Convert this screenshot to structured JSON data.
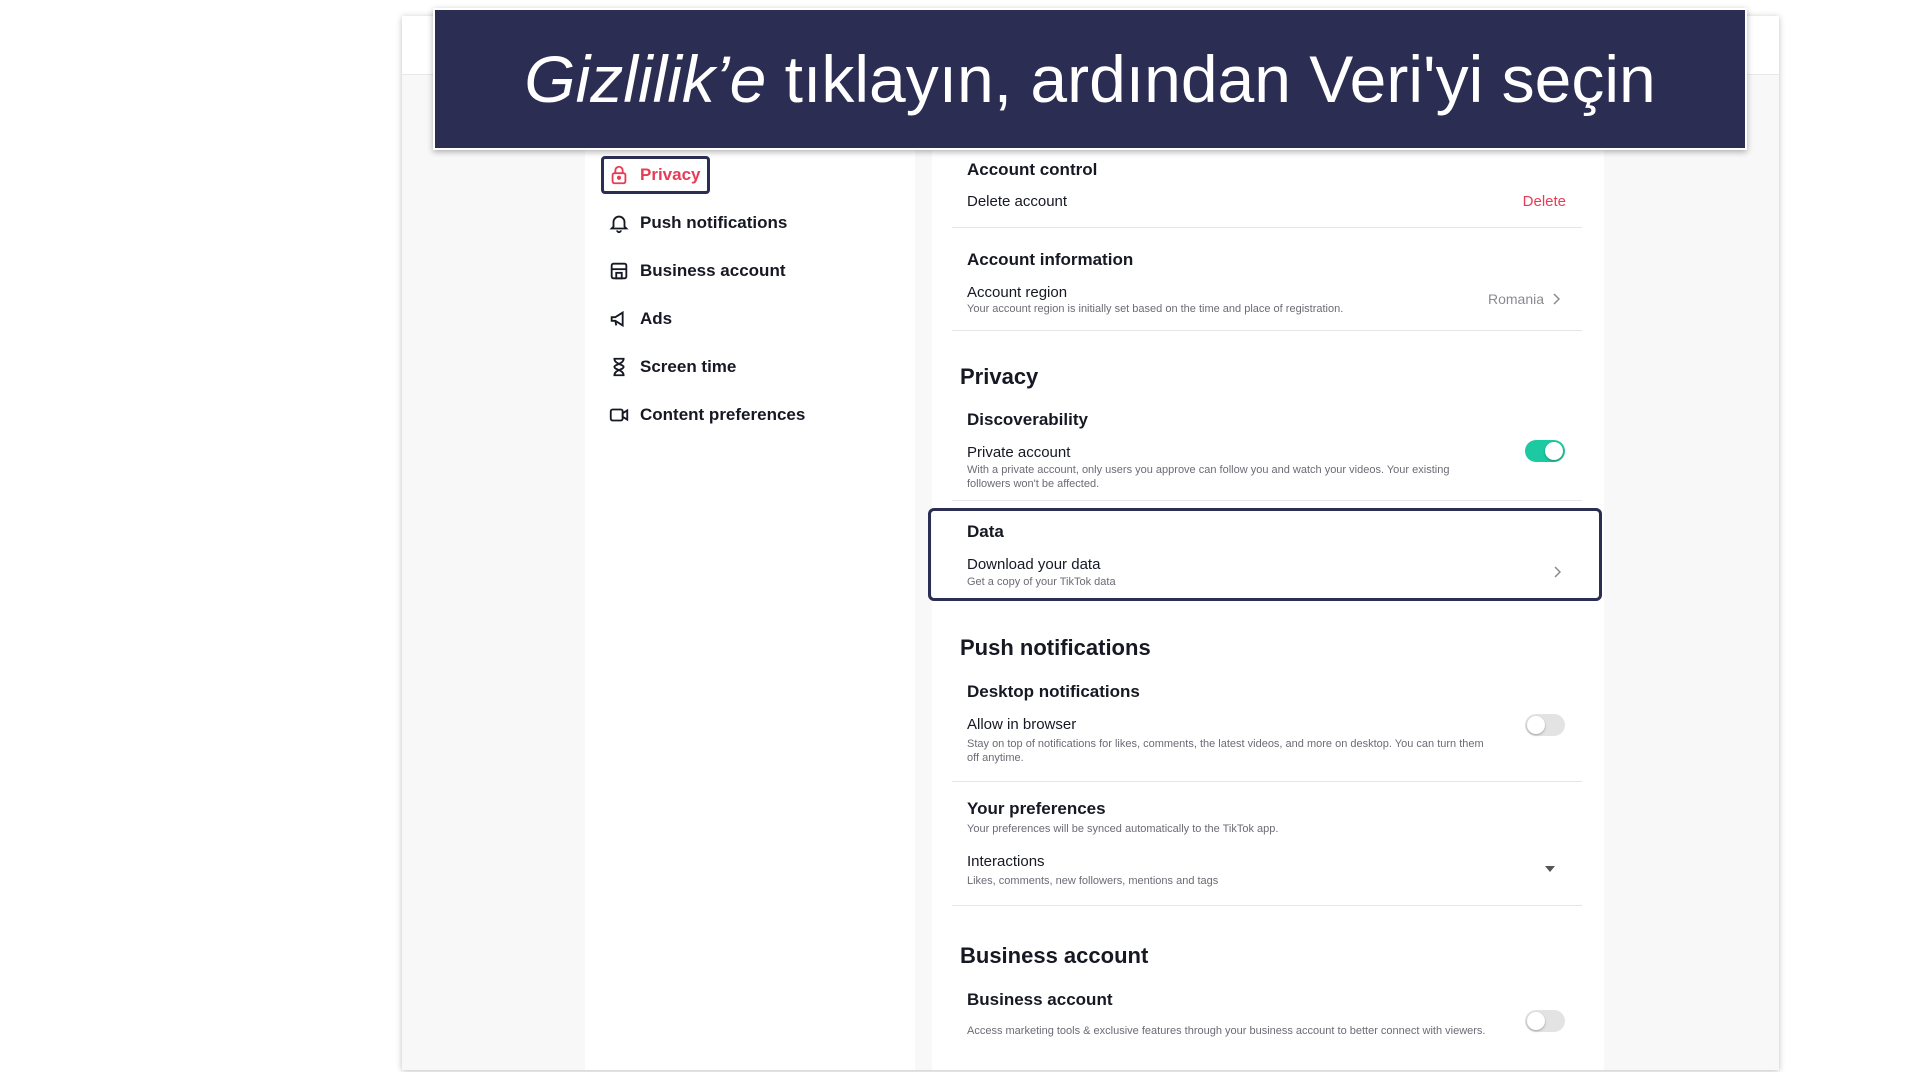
{
  "banner": {
    "italic_part": "Gizlilik’e",
    "rest": " tıklayın, ardından Veri'yi seçin"
  },
  "sidebar": {
    "items": [
      {
        "label": "Privacy",
        "icon": "lock-icon",
        "active": true
      },
      {
        "label": "Push notifications",
        "icon": "bell-icon"
      },
      {
        "label": "Business account",
        "icon": "store-icon"
      },
      {
        "label": "Ads",
        "icon": "megaphone-icon"
      },
      {
        "label": "Screen time",
        "icon": "hourglass-icon"
      },
      {
        "label": "Content preferences",
        "icon": "video-camera-icon"
      }
    ]
  },
  "account": {
    "control_title": "Account control",
    "delete_row": "Delete account",
    "delete_action": "Delete",
    "info_title": "Account information",
    "region_label": "Account region",
    "region_desc": "Your account region is initially set based on the time and place of registration.",
    "region_value": "Romania"
  },
  "privacy": {
    "heading": "Privacy",
    "discover_title": "Discoverability",
    "private_label": "Private account",
    "private_desc": "With a private account, only users you approve can follow you and watch your videos. Your existing followers won't be affected.",
    "private_on": true,
    "data_title": "Data",
    "download_label": "Download your data",
    "download_desc": "Get a copy of your TikTok data"
  },
  "push": {
    "heading": "Push notifications",
    "desktop_title": "Desktop notifications",
    "browser_label": "Allow in browser",
    "browser_desc": "Stay on top of notifications for likes, comments, the latest videos, and more on desktop. You can turn them off anytime.",
    "browser_on": false,
    "prefs_title": "Your preferences",
    "prefs_desc": "Your preferences will be synced automatically to the TikTok app.",
    "interactions_label": "Interactions",
    "interactions_desc": "Likes, comments, new followers, mentions and tags"
  },
  "business": {
    "heading": "Business account",
    "title": "Business account",
    "desc": "Access marketing tools & exclusive features through your business account to better connect with viewers.",
    "on": false
  },
  "colors": {
    "accent": "#e83b55",
    "toggle_on": "#1dc9a0",
    "highlight": "#2b2d52"
  }
}
